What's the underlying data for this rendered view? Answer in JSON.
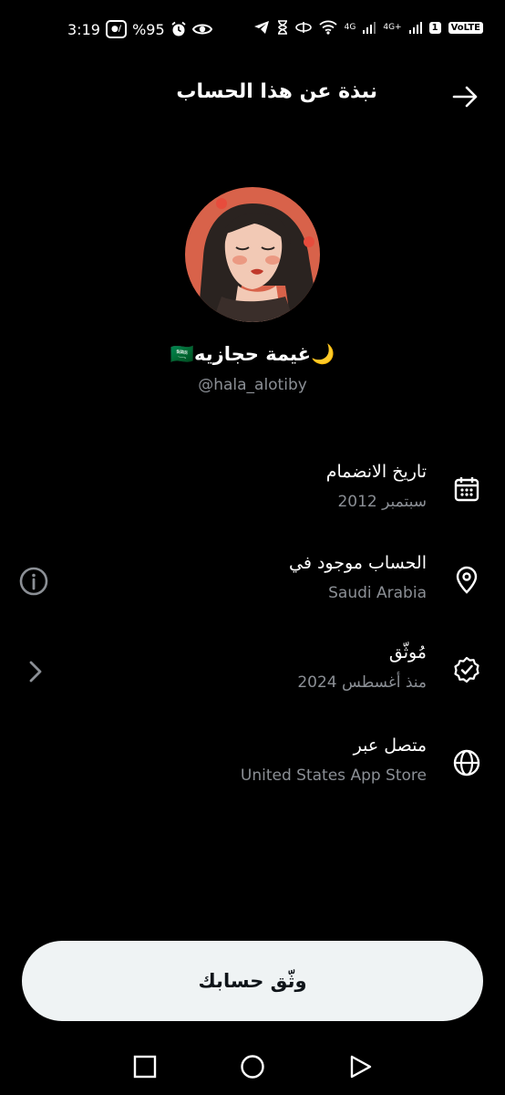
{
  "status_bar": {
    "time": "3:19",
    "battery": "%95",
    "signal_1": "4G",
    "signal_2": "4G+",
    "sim": "1",
    "volte": "VoLTE"
  },
  "header": {
    "title": "نبذة عن هذا الحساب"
  },
  "profile": {
    "display_name": "🌙غيمة حجازيه🇸🇦",
    "handle": "@hala_alotiby"
  },
  "info_items": [
    {
      "label": "تاريخ الانضمام",
      "value": "سبتمبر 2012",
      "icon": "calendar-icon"
    },
    {
      "label": "الحساب موجود في",
      "value": "Saudi Arabia",
      "icon": "location-pin-icon"
    },
    {
      "label": "مُوثّق",
      "value": "منذ أغسطس 2024",
      "icon": "verified-badge-icon"
    },
    {
      "label": "متصل عبر",
      "value": "United States App Store",
      "icon": "globe-icon"
    }
  ],
  "actions": {
    "verify_label": "وثّق حسابك"
  },
  "colors": {
    "background": "#000000",
    "secondary_text": "#8b8f95",
    "button_bg": "#eff3f4",
    "button_text": "#0f1419"
  }
}
